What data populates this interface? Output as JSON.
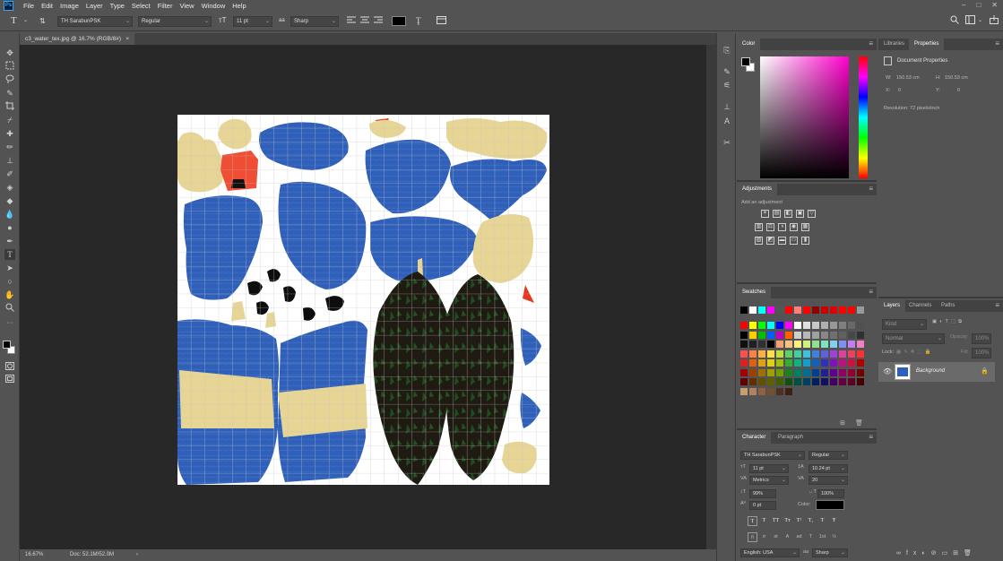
{
  "app": {
    "logo": "Ps",
    "menus": [
      "File",
      "Edit",
      "Image",
      "Layer",
      "Type",
      "Select",
      "Filter",
      "View",
      "Window",
      "Help"
    ],
    "window_controls": [
      "–",
      "□",
      "✕"
    ]
  },
  "options_bar": {
    "font_family": "TH SarabunPSK",
    "font_style": "Regular",
    "font_size": "11 pt",
    "aa_label": "aa",
    "antialias": "Sharp",
    "color": "#000000"
  },
  "document": {
    "tab_title": "c3_water_tex.jpg @ 16.7% (RGB/8#)",
    "close": "×"
  },
  "status": {
    "zoom": "16.67%",
    "doc_size": "Doc: 52.1M/52.0M",
    "arrow": "›"
  },
  "color_panel": {
    "tab": "Color",
    "fg": "#000000",
    "bg": "#ffffff"
  },
  "adjustments_panel": {
    "tab": "Adjustments",
    "label": "Add an adjustment"
  },
  "swatches_panel": {
    "tab": "Swatches"
  },
  "character_panel": {
    "tabs": [
      "Character",
      "Paragraph"
    ],
    "font_family": "TH SarabunPSK",
    "font_style": "Regular",
    "size": "11 pt",
    "leading": "10.24 pt",
    "kerning": "Metrics",
    "tracking": "20",
    "vscale": "99%",
    "hscale": "100%",
    "baseline": "0 pt",
    "color_label": "Color:",
    "language": "English: USA",
    "aa_label": "aa",
    "antialias": "Sharp",
    "style_buttons": [
      "T",
      "T",
      "TT",
      "Tт",
      "T¹",
      "T₁",
      "T",
      "Ŧ"
    ],
    "ot_buttons": [
      "fi",
      "ơ",
      "st",
      "A",
      "ad",
      "T",
      "1st",
      "½"
    ]
  },
  "properties_panel": {
    "tabs": [
      "Libraries",
      "Properties"
    ],
    "title": "Document Properties",
    "w_label": "W:",
    "w": "150.53 cm",
    "h_label": "H:",
    "h": "150.53 cm",
    "x_label": "X:",
    "x": "0",
    "y_label": "Y:",
    "y": "0",
    "resolution": "Resolution: 72 pixels/inch"
  },
  "layers_panel": {
    "tabs": [
      "Layers",
      "Channels",
      "Paths"
    ],
    "kind": "Kind",
    "blend": "Normal",
    "opacity_label": "Opacity:",
    "opacity": "100%",
    "lock_label": "Lock:",
    "fill_label": "Fill:",
    "fill": "100%",
    "layer_name": "Background"
  }
}
